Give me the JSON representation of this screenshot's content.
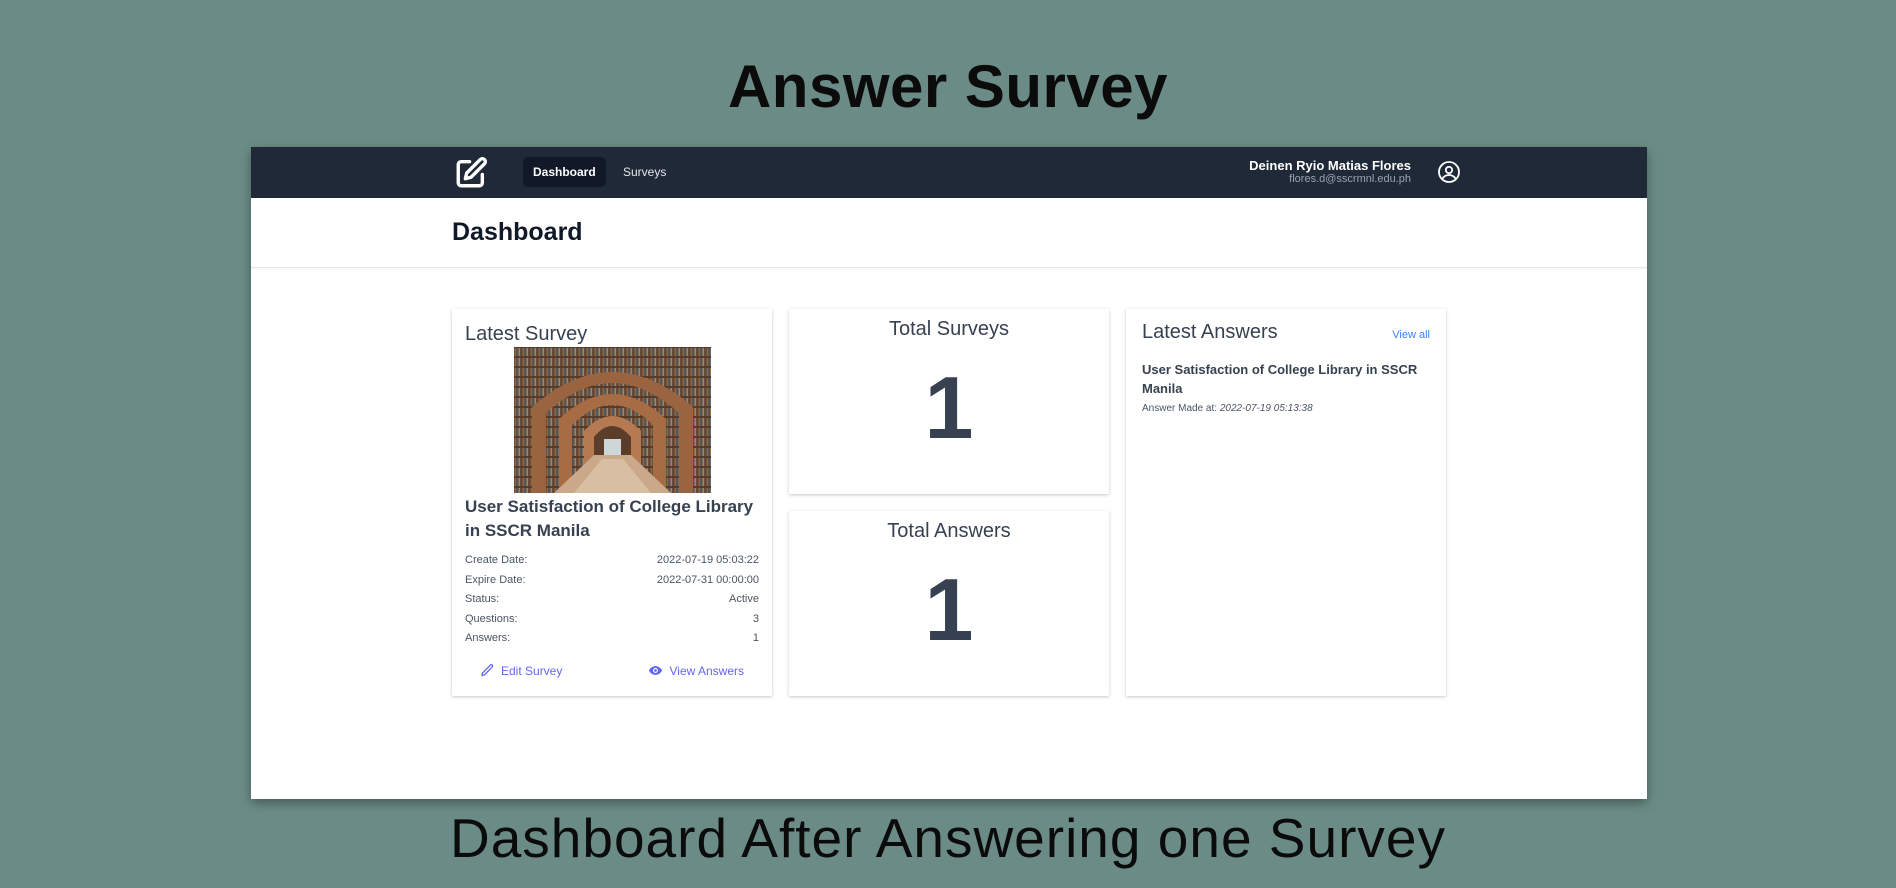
{
  "slide": {
    "title": "Answer Survey",
    "caption": "Dashboard After Answering one Survey"
  },
  "navbar": {
    "logo_icon": "edit-square-icon",
    "links": [
      {
        "label": "Dashboard",
        "active": true
      },
      {
        "label": "Surveys",
        "active": false
      }
    ],
    "user": {
      "name": "Deinen Ryio Matias Flores",
      "email": "flores.d@sscrmnl.edu.ph",
      "icon": "user-circle-icon"
    }
  },
  "page": {
    "title": "Dashboard"
  },
  "latest_survey": {
    "heading": "Latest Survey",
    "image_alt": "library-arches-image",
    "title": "User Satisfaction of College Library in SSCR Manila",
    "details": [
      {
        "label": "Create Date:",
        "value": "2022-07-19 05:03:22"
      },
      {
        "label": "Expire Date:",
        "value": "2022-07-31 00:00:00"
      },
      {
        "label": "Status:",
        "value": "Active"
      },
      {
        "label": "Questions:",
        "value": "3"
      },
      {
        "label": "Answers:",
        "value": "1"
      }
    ],
    "edit_label": "Edit Survey",
    "view_answers_label": "View Answers"
  },
  "total_surveys": {
    "heading": "Total Surveys",
    "value": "1"
  },
  "total_answers": {
    "heading": "Total Answers",
    "value": "1"
  },
  "latest_answers": {
    "heading": "Latest Answers",
    "view_all_label": "View all",
    "items": [
      {
        "title": "User Satisfaction of College Library in SSCR Manila",
        "meta_label": "Answer Made at:",
        "meta_value": "2022-07-19 05:13:38"
      }
    ]
  },
  "colors": {
    "background": "#6b8c86",
    "navbar": "#1f2937",
    "accent": "#6366f1",
    "link": "#3b82f6"
  }
}
